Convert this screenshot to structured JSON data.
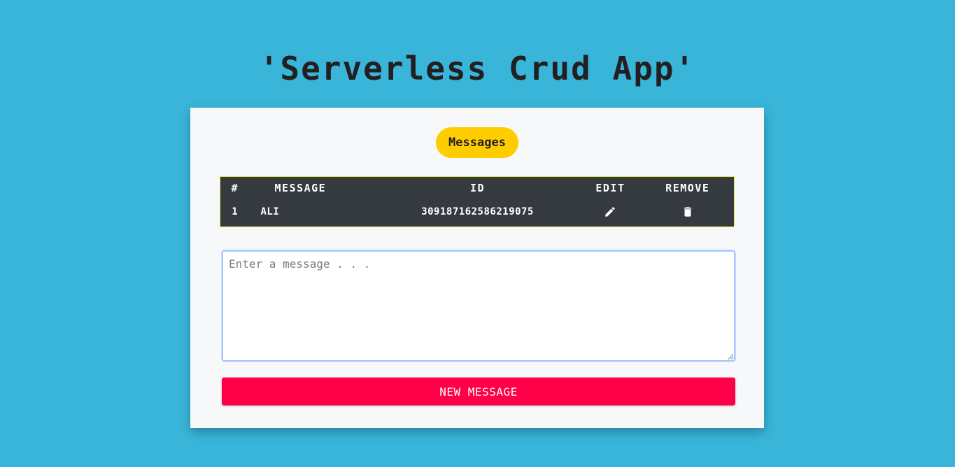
{
  "page": {
    "title": "'Serverless Crud App'"
  },
  "card": {
    "badge": "Messages"
  },
  "table": {
    "headers": {
      "num": "#",
      "message": "MESSAGE",
      "id": "ID",
      "edit": "EDIT",
      "remove": "REMOVE"
    },
    "rows": [
      {
        "num": "1",
        "message": "ALI",
        "id": "309187162586219075",
        "edit_icon": "pencil-icon",
        "remove_icon": "trash-icon"
      }
    ]
  },
  "form": {
    "message_value": "",
    "message_placeholder": "Enter a message . . .",
    "submit_label": "NEW MESSAGE"
  },
  "colors": {
    "background": "#38b5d9",
    "badge": "#ffcc00",
    "table": "#343a40",
    "button": "#ff0048"
  }
}
